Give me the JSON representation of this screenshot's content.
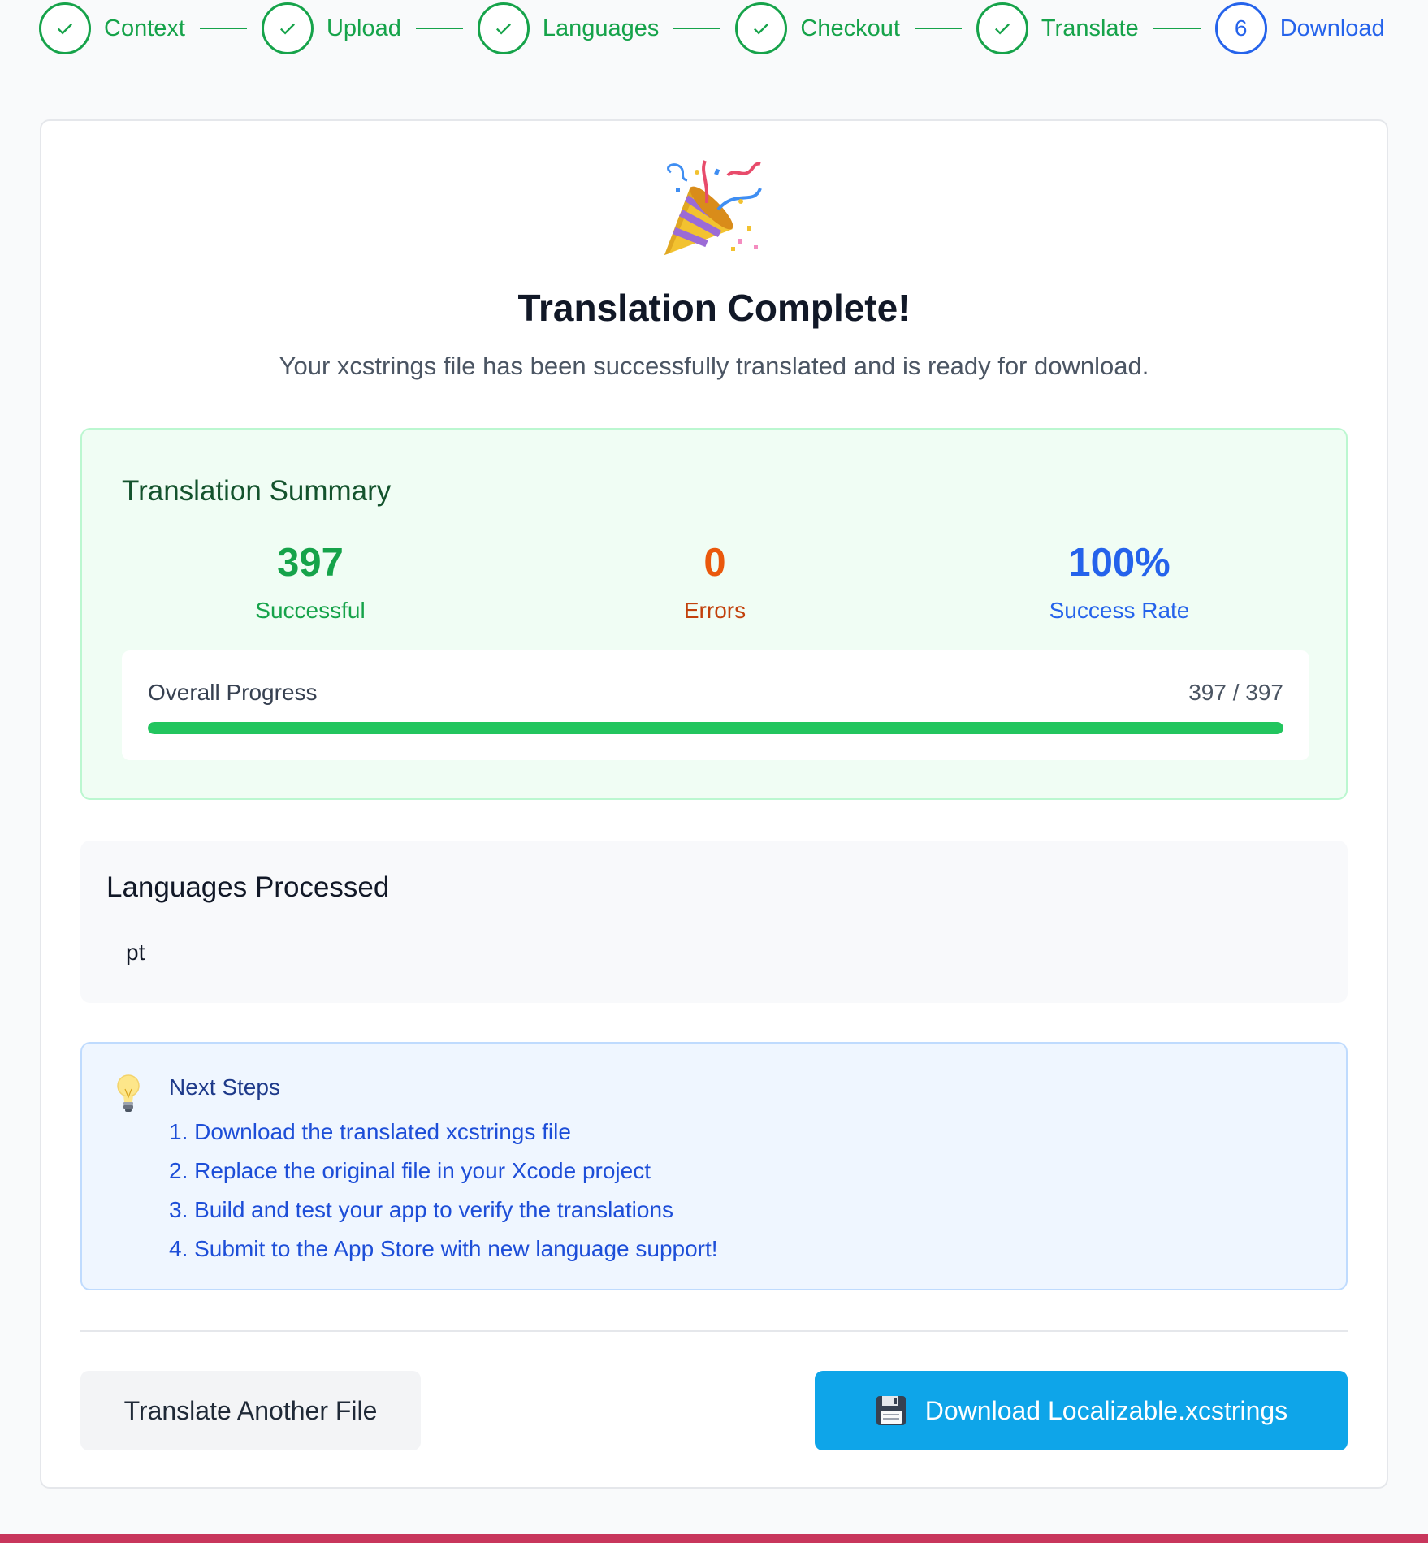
{
  "stepper": {
    "steps": [
      {
        "label": "Context",
        "state": "done"
      },
      {
        "label": "Upload",
        "state": "done"
      },
      {
        "label": "Languages",
        "state": "done"
      },
      {
        "label": "Checkout",
        "state": "done"
      },
      {
        "label": "Translate",
        "state": "done"
      },
      {
        "label": "Download",
        "state": "active",
        "number": "6"
      }
    ]
  },
  "hero": {
    "icon": "party-popper-icon",
    "title": "Translation Complete!",
    "subtitle": "Your xcstrings file has been successfully translated and is ready for download."
  },
  "summary": {
    "title": "Translation Summary",
    "successful": {
      "value": "397",
      "label": "Successful"
    },
    "errors": {
      "value": "0",
      "label": "Errors"
    },
    "success_rate": {
      "value": "100%",
      "label": "Success Rate"
    },
    "progress": {
      "label": "Overall Progress",
      "count": "397 / 397",
      "fraction": 1.0
    }
  },
  "languages": {
    "title": "Languages Processed",
    "items": [
      "pt"
    ]
  },
  "next_steps": {
    "icon": "lightbulb-icon",
    "title": "Next Steps",
    "items": [
      "1. Download the translated xcstrings file",
      "2. Replace the original file in your Xcode project",
      "3. Build and test your app to verify the translations",
      "4. Submit to the App Store with new language support!"
    ]
  },
  "actions": {
    "secondary_label": "Translate Another File",
    "primary_label": "Download Localizable.xcstrings",
    "primary_icon": "floppy-disk-icon"
  },
  "colors": {
    "success": "#16a34a",
    "error": "#ea580c",
    "info": "#2563eb",
    "primary_button": "#0ea5e9"
  }
}
